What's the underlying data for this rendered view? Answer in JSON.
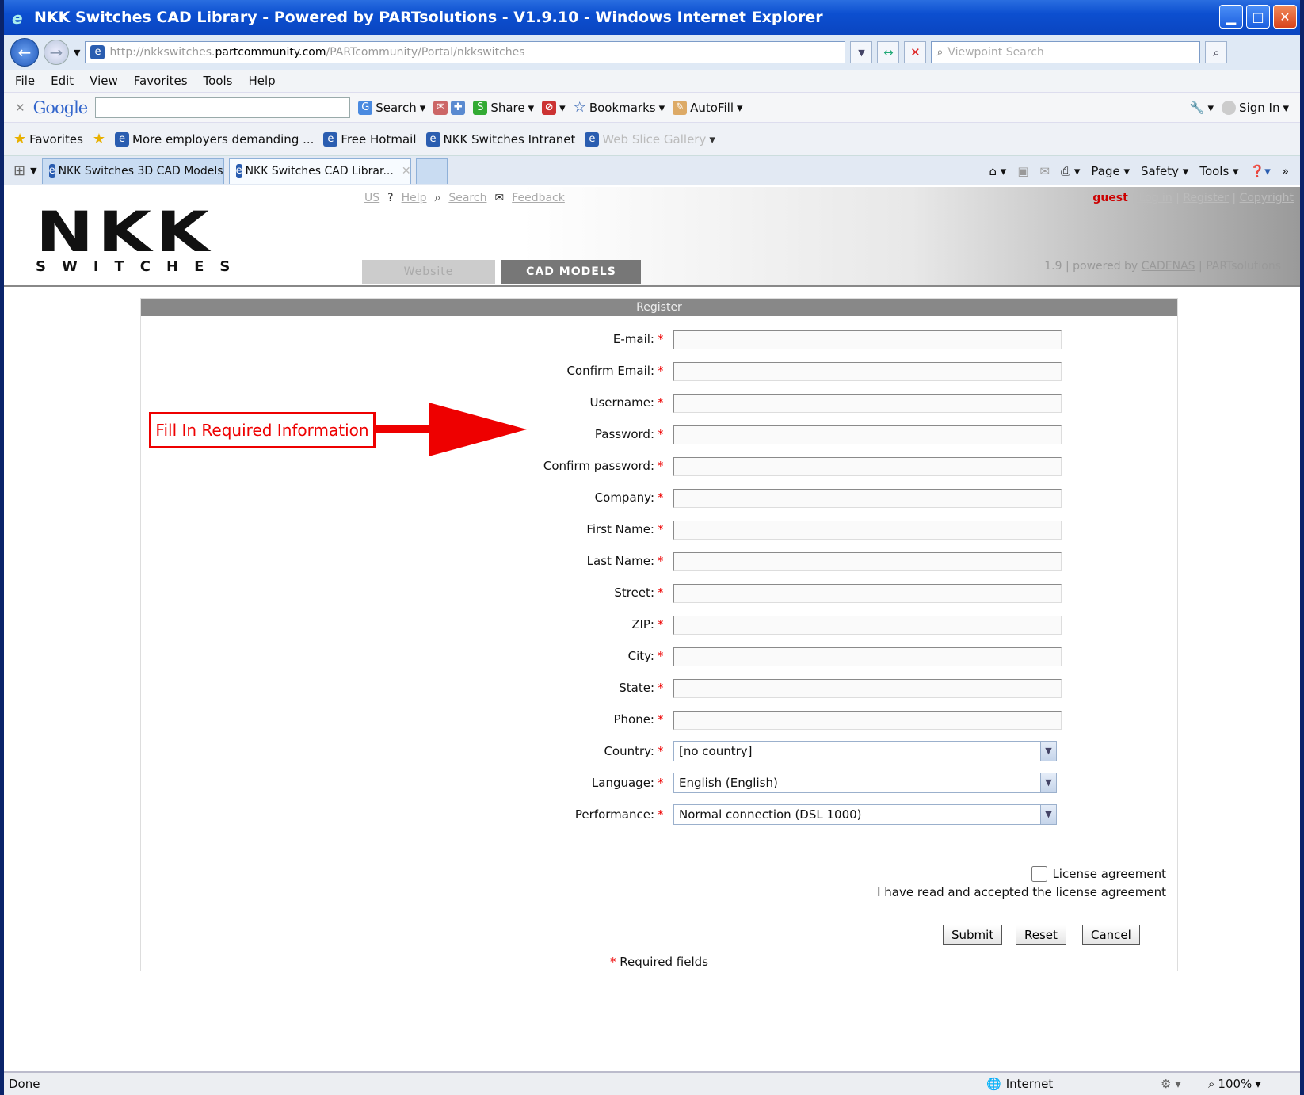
{
  "window": {
    "title": "NKK Switches CAD Library - Powered by PARTsolutions - V1.9.10 - Windows Internet Explorer"
  },
  "address_bar": {
    "url_prefix": "http://nkkswitches.",
    "url_domain": "partcommunity.com",
    "url_suffix": "/PARTcommunity/Portal/nkkswitches",
    "search_placeholder": "Viewpoint Search"
  },
  "menu": [
    "File",
    "Edit",
    "View",
    "Favorites",
    "Tools",
    "Help"
  ],
  "google_toolbar": {
    "logo": "Google",
    "search": "Search",
    "share": "Share",
    "bookmarks": "Bookmarks",
    "autofill": "AutoFill",
    "sign_in": "Sign In"
  },
  "favorites_bar": {
    "favorites": "Favorites",
    "items": [
      "More employers demanding ...",
      "Free Hotmail",
      "NKK Switches Intranet",
      "Web Slice Gallery"
    ]
  },
  "tabs": [
    {
      "label": "NKK Switches 3D CAD Models"
    },
    {
      "label": "NKK Switches CAD Librar..."
    }
  ],
  "command_bar": {
    "page": "Page",
    "safety": "Safety",
    "tools": "Tools"
  },
  "site_header": {
    "logo_main": "NKK",
    "logo_sub": "SWITCHES",
    "lang": "US",
    "help": "Help",
    "search": "Search",
    "feedback": "Feedback",
    "guest": "guest",
    "login": "Log in",
    "register": "Register",
    "copyright": "Copyright",
    "tab_website": "Website",
    "tab_cad": "CAD MODELS",
    "powered_prefix": "1.9 | powered by",
    "powered_cadenas": "CADENAS",
    "powered_suffix": "| PARTsolutions"
  },
  "form": {
    "title": "Register",
    "fields": [
      {
        "label": "E-mail:",
        "value": ""
      },
      {
        "label": "Confirm Email:",
        "value": ""
      },
      {
        "label": "Username:",
        "value": ""
      },
      {
        "label": "Password:",
        "value": ""
      },
      {
        "label": "Confirm password:",
        "value": ""
      },
      {
        "label": "Company:",
        "value": ""
      },
      {
        "label": "First Name:",
        "value": ""
      },
      {
        "label": "Last Name:",
        "value": ""
      },
      {
        "label": "Street:",
        "value": ""
      },
      {
        "label": "ZIP:",
        "value": ""
      },
      {
        "label": "City:",
        "value": ""
      },
      {
        "label": "State:",
        "value": ""
      },
      {
        "label": "Phone:",
        "value": ""
      }
    ],
    "selects": [
      {
        "label": "Country:",
        "value": "[no country]"
      },
      {
        "label": "Language:",
        "value": "English (English)"
      },
      {
        "label": "Performance:",
        "value": "Normal connection (DSL 1000)"
      }
    ],
    "license_link": "License agreement",
    "license_text": "I have read and accepted the license agreement",
    "submit": "Submit",
    "reset": "Reset",
    "cancel": "Cancel",
    "required_note": "Required fields",
    "star": "*"
  },
  "callout": "Fill In Required Information",
  "status_bar": {
    "left": "Done",
    "zone": "Internet",
    "zoom": "100%"
  },
  "colors": {
    "title_bar": "#0c4fd0",
    "required": "#e00000",
    "callout": "#e00000"
  }
}
